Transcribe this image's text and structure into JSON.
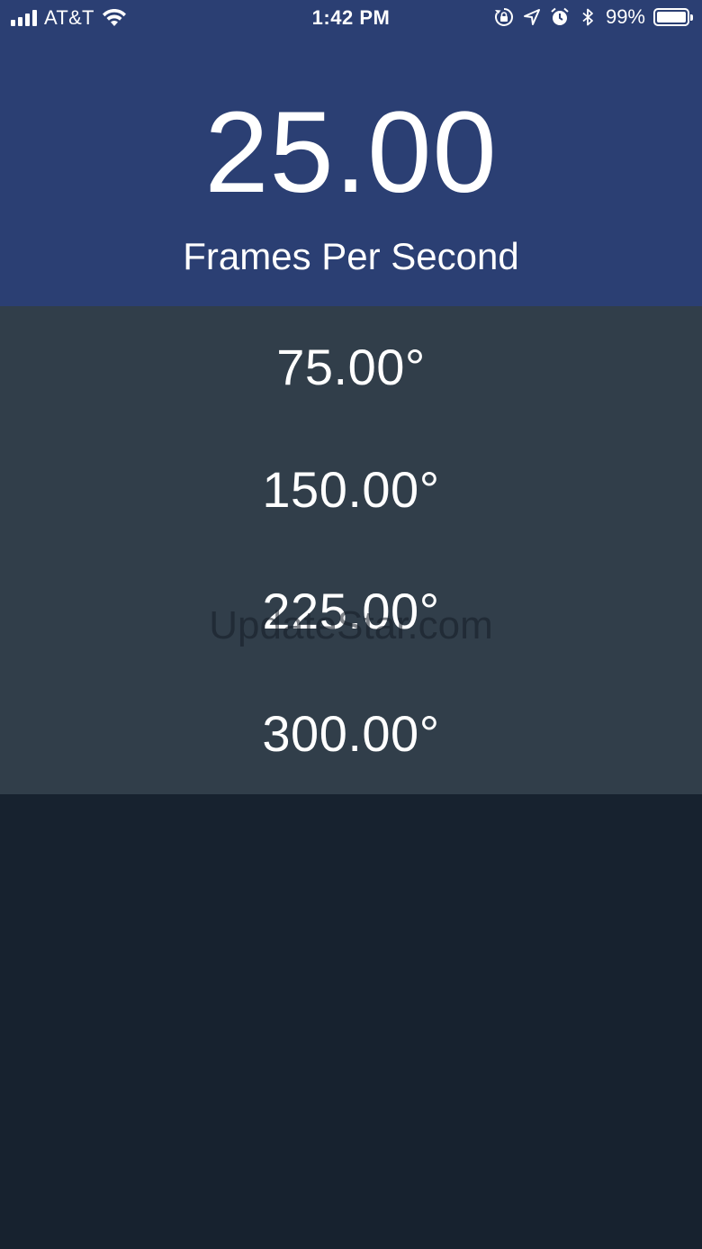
{
  "status_bar": {
    "carrier": "AT&T",
    "time": "1:42 PM",
    "battery_percent_text": "99%",
    "battery_level": 0.99,
    "icons": [
      "signal-icon",
      "wifi-icon",
      "orientation-lock-icon",
      "location-icon",
      "alarm-icon",
      "bluetooth-icon",
      "battery-icon"
    ]
  },
  "fps": {
    "value": "25.00",
    "label": "Frames Per Second"
  },
  "angles": [
    {
      "value": "75.00°"
    },
    {
      "value": "150.00°"
    },
    {
      "value": "225.00°"
    },
    {
      "value": "300.00°"
    }
  ],
  "watermark": "UpdateStar.com",
  "colors": {
    "header_bg": "#2b3f73",
    "list_bg": "#313e4a",
    "page_bg": "#17222f",
    "text": "#ffffff"
  }
}
